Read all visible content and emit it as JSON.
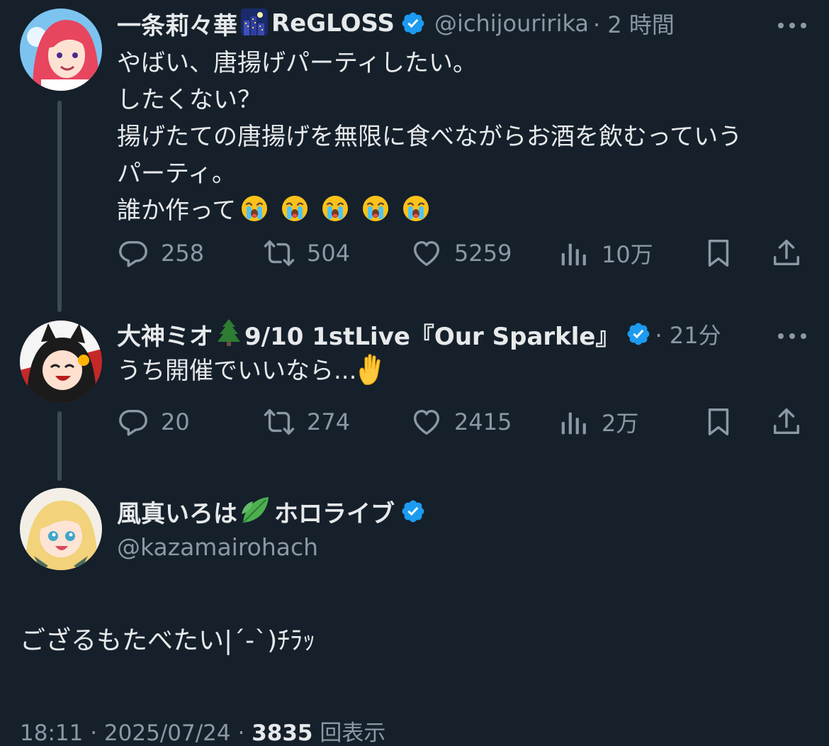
{
  "tweets": [
    {
      "name": "一条莉々華",
      "name_suffix": "ReGLOSS",
      "handle": "@ichijouririka",
      "time": "· 2 時間",
      "lines": [
        "やばい、唐揚げパーティしたい。",
        "したくない？",
        "揚げたての唐揚げを無限に食べながらお酒を飲むっていう",
        "パーティ。",
        "誰か作って"
      ],
      "replies": "258",
      "retweets": "504",
      "likes": "5259",
      "views": "10万"
    },
    {
      "name": "大神ミオ",
      "name_suffix": "9/10 1stLive『Our Sparkle』",
      "handle": "",
      "time": "· 21分",
      "lines": [
        "うち開催でいいなら..."
      ],
      "replies": "20",
      "retweets": "274",
      "likes": "2415",
      "views": "2万"
    },
    {
      "name": "風真いろは",
      "name_suffix": "ホロライブ",
      "handle": "@kazamairohach",
      "lines": [
        "ござるもたべたい|´-`)ﾁﾗｯ"
      ]
    }
  ],
  "footer": {
    "time": "18:11",
    "date": "2025/07/24",
    "views_count": "3835",
    "views_label": "回表示"
  },
  "colors": {
    "background": "#15202b",
    "text": "#e7e9ea",
    "muted": "#8b98a5",
    "verified": "#1d9bf0",
    "thread_line": "#3c4a57"
  },
  "icons": [
    "verified-badge-icon",
    "more-icon",
    "reply-icon",
    "retweet-icon",
    "like-icon",
    "views-icon",
    "bookmark-icon",
    "share-icon",
    "loudly-crying-face-emoji",
    "christmas-tree-emoji",
    "raised-hand-emoji",
    "leaf-emoji",
    "night-city-emoji"
  ]
}
